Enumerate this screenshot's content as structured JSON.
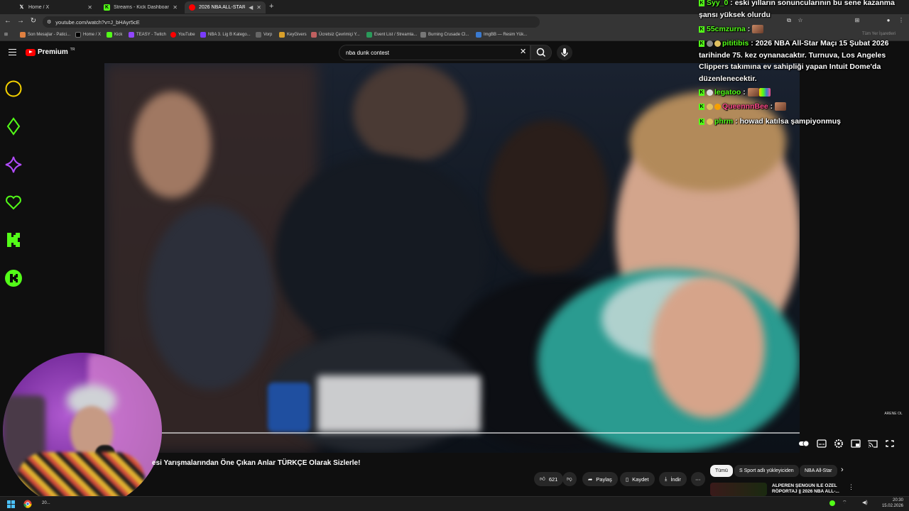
{
  "browser": {
    "tabs": [
      {
        "title": "Home / X",
        "favicon": "x-icon",
        "color": "#000000"
      },
      {
        "title": "Streams - Kick Dashboard",
        "favicon": "kick-icon",
        "color": "#53fc18"
      },
      {
        "title": "2026 NBA ALL-STAR Ca...",
        "favicon": "youtube-icon",
        "color": "#ff0000"
      }
    ],
    "new_tab": "+",
    "url": "youtube.com/watch?v=J_bHAyr5cE",
    "bookmarks": [
      "Son Mesajlar - Patici...",
      "Home / X",
      "Kick",
      "TEASY - Twitch",
      "YouTube",
      "NBA 3. Lig B Katego...",
      "Vorp",
      "KeyGivers",
      "Ücretsiz Çevrimiçi Y...",
      "Event List / Streamla...",
      "Burning Crusade Cl...",
      "ImgBB — Resim Yük..."
    ],
    "bookmarks_more": "Tüm Yer İşaretleri"
  },
  "youtube": {
    "brand": "Premium",
    "region": "TR",
    "search_value": "nba dunk contest",
    "video_title": "esi Yarışmalarından Öne Çıkan Anlar TÜRKÇE Olarak Sizlerle!",
    "likes": "621",
    "actions": {
      "share": "Paylaş",
      "save": "Kaydet",
      "download": "İndir"
    },
    "chips": [
      "Tümü",
      "S Sport adlı yükleyiciden",
      "NBA All-Star"
    ],
    "recommended_title": "ALPEREN ŞENGÜN İLE ÖZEL RÖPORTAJ || 2026 NBA ALL-...",
    "watermark": "ARENE OL",
    "progress_fraction": 1.0
  },
  "chat": [
    {
      "user": "Syy_0",
      "user_color": "#53fc18",
      "text": "eski yılların sonuncularının bu sene kazanma şansı yüksek olurdu",
      "emote": false
    },
    {
      "user": "55cmzurna",
      "user_color": "#53fc18",
      "text": "",
      "emote": true
    },
    {
      "user": "pititibis",
      "user_color": "#53fc18",
      "text": "2026 NBA All-Star Maçı 15 Şubat 2026 tarihinde 75. kez oynanacaktır. Turnuva, Los Angeles Clippers takımına ev sahipliği yapan Intuit Dome'da düzenlenecektir.",
      "emote": false
    },
    {
      "user": "legatoo",
      "user_color": "#53fc18",
      "text": "",
      "emote": true
    },
    {
      "user": "QueennnBee",
      "user_color": "#ff4b8b",
      "text": "",
      "emote": true
    },
    {
      "user": "phrm",
      "user_color": "#53fc18",
      "text": "howad katılsa şampiyonmuş",
      "emote": false
    }
  ],
  "taskbar": {
    "time": "20:30",
    "date": "15.02.2026",
    "app_label": "20..."
  },
  "colors": {
    "kick_green": "#53fc18",
    "yt_red": "#ff0000",
    "overlay_yellow": "#f5d200",
    "overlay_purple": "#b24cff"
  }
}
